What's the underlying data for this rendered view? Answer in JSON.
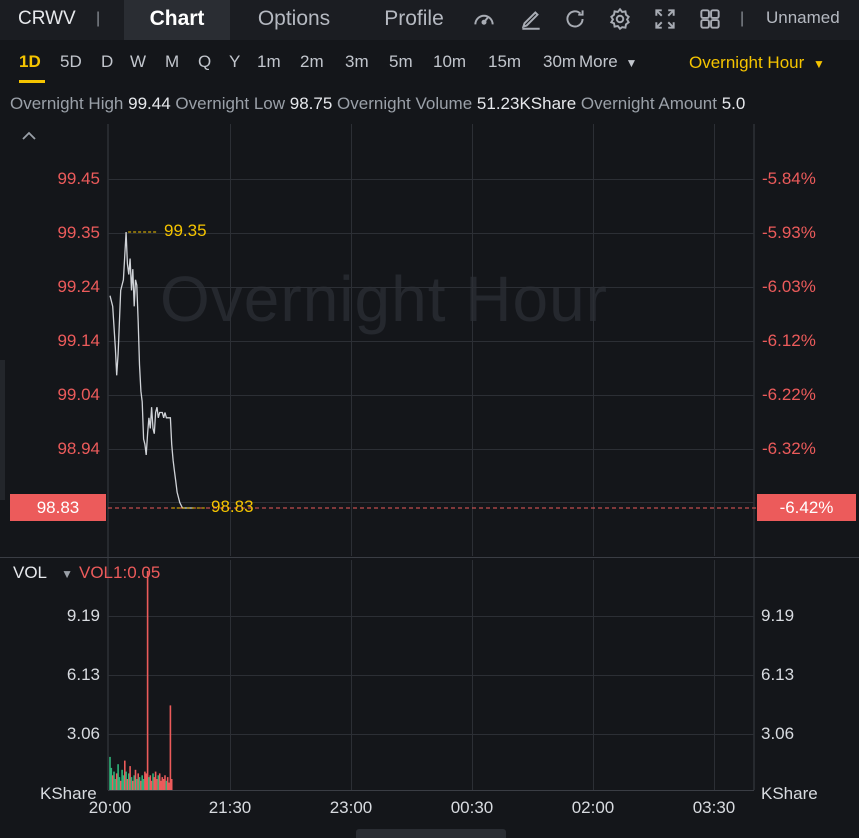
{
  "header": {
    "symbol": "CRWV",
    "tabs": [
      {
        "label": "Chart",
        "active": true
      },
      {
        "label": "Options",
        "active": false
      },
      {
        "label": "Profile",
        "active": false
      }
    ],
    "icons": [
      "speedometer-icon",
      "draw-icon",
      "refresh-icon",
      "settings-icon",
      "fullscreen-icon",
      "layout-icon"
    ],
    "layout_name": "Unnamed"
  },
  "periods": [
    "1D",
    "5D",
    "D",
    "W",
    "M",
    "Q",
    "Y",
    "1m",
    "2m",
    "3m",
    "5m",
    "10m",
    "15m",
    "30m"
  ],
  "active_period": "1D",
  "more_label": "More",
  "session_label": "Overnight Hour",
  "stats": {
    "high_label": "Overnight High",
    "high": "99.44",
    "low_label": "Overnight Low",
    "low": "98.75",
    "volume_label": "Overnight Volume",
    "volume": "51.23KShare",
    "amount_label": "Overnight Amount",
    "amount": "5.0"
  },
  "watermark": "Overnight Hour",
  "indicator": {
    "name": "VOL",
    "param": "VOL1:0.05"
  },
  "colors": {
    "up": "#ec5b5b",
    "down": "#2fb37a",
    "accent": "#f5c400",
    "price_line": "#d0d3d8"
  },
  "chart_data": {
    "type": "line",
    "price_axis_left": [
      "99.45",
      "99.35",
      "99.24",
      "99.14",
      "99.04",
      "98.94"
    ],
    "price_axis_right": [
      "-5.84%",
      "-5.93%",
      "-6.03%",
      "-6.12%",
      "-6.22%",
      "-6.32%"
    ],
    "ylim": [
      98.83,
      99.45
    ],
    "x_ticks": [
      "20:00",
      "21:30",
      "23:00",
      "00:30",
      "02:00",
      "03:30"
    ],
    "current_price": "98.83",
    "current_change": "-6.42%",
    "high_marker": "99.35",
    "low_marker": "98.83",
    "price_minutes": [
      0,
      2,
      4,
      5,
      6,
      8,
      10,
      12,
      13,
      14,
      15,
      16,
      17,
      18,
      19,
      20,
      21,
      22,
      23,
      24,
      25,
      26,
      27,
      28,
      29,
      30,
      31,
      32,
      33,
      34,
      35,
      36,
      37,
      38,
      39,
      40,
      41,
      42,
      43,
      44,
      45,
      46,
      47,
      48,
      49,
      50,
      52,
      54,
      56,
      58,
      60,
      62
    ],
    "price_values": [
      99.23,
      99.21,
      99.13,
      99.08,
      99.12,
      99.24,
      99.26,
      99.35,
      99.29,
      99.27,
      99.3,
      99.24,
      99.28,
      99.21,
      99.26,
      99.25,
      99.18,
      99.1,
      99.05,
      99.03,
      98.96,
      98.95,
      98.93,
      98.97,
      99.0,
      98.98,
      99.02,
      98.98,
      98.97,
      99.01,
      99.02,
      99.0,
      99.01,
      99.01,
      99.01,
      99.0,
      99.01,
      99.0,
      99.0,
      99.0,
      99.0,
      98.95,
      98.92,
      98.9,
      98.88,
      98.86,
      98.84,
      98.83,
      98.83,
      98.83,
      98.83,
      98.83
    ],
    "volume_axis": [
      "9.19",
      "6.13",
      "3.06"
    ],
    "volume_unit": "KShare",
    "volume_ylim": [
      0,
      12.5
    ],
    "volume_bars": [
      [
        0,
        1.8,
        "down"
      ],
      [
        1,
        1.2,
        "down"
      ],
      [
        2,
        0.8,
        "up"
      ],
      [
        3,
        1.0,
        "down"
      ],
      [
        4,
        0.6,
        "down"
      ],
      [
        5,
        0.9,
        "up"
      ],
      [
        6,
        1.4,
        "down"
      ],
      [
        7,
        0.7,
        "down"
      ],
      [
        8,
        0.5,
        "up"
      ],
      [
        9,
        1.1,
        "down"
      ],
      [
        10,
        0.8,
        "down"
      ],
      [
        11,
        1.6,
        "up"
      ],
      [
        12,
        1.0,
        "down"
      ],
      [
        13,
        0.6,
        "up"
      ],
      [
        14,
        0.9,
        "down"
      ],
      [
        15,
        1.3,
        "up"
      ],
      [
        16,
        0.7,
        "down"
      ],
      [
        17,
        0.5,
        "up"
      ],
      [
        18,
        0.8,
        "down"
      ],
      [
        19,
        1.1,
        "up"
      ],
      [
        20,
        0.6,
        "down"
      ],
      [
        21,
        0.9,
        "up"
      ],
      [
        22,
        0.7,
        "down"
      ],
      [
        23,
        0.5,
        "up"
      ],
      [
        24,
        0.8,
        "down"
      ],
      [
        25,
        0.6,
        "down"
      ],
      [
        26,
        1.0,
        "up"
      ],
      [
        27,
        0.9,
        "up"
      ],
      [
        28,
        11.9,
        "up"
      ],
      [
        29,
        0.7,
        "down"
      ],
      [
        30,
        0.8,
        "up"
      ],
      [
        31,
        0.5,
        "up"
      ],
      [
        32,
        0.9,
        "down"
      ],
      [
        33,
        0.7,
        "up"
      ],
      [
        34,
        1.0,
        "up"
      ],
      [
        35,
        0.6,
        "up"
      ],
      [
        36,
        0.8,
        "down"
      ],
      [
        37,
        0.9,
        "up"
      ],
      [
        38,
        0.5,
        "up"
      ],
      [
        39,
        0.7,
        "up"
      ],
      [
        40,
        0.6,
        "up"
      ],
      [
        41,
        0.8,
        "up"
      ],
      [
        42,
        0.5,
        "down"
      ],
      [
        43,
        0.7,
        "up"
      ],
      [
        44,
        0.4,
        "up"
      ],
      [
        45,
        4.6,
        "up"
      ],
      [
        46,
        0.6,
        "up"
      ]
    ]
  }
}
